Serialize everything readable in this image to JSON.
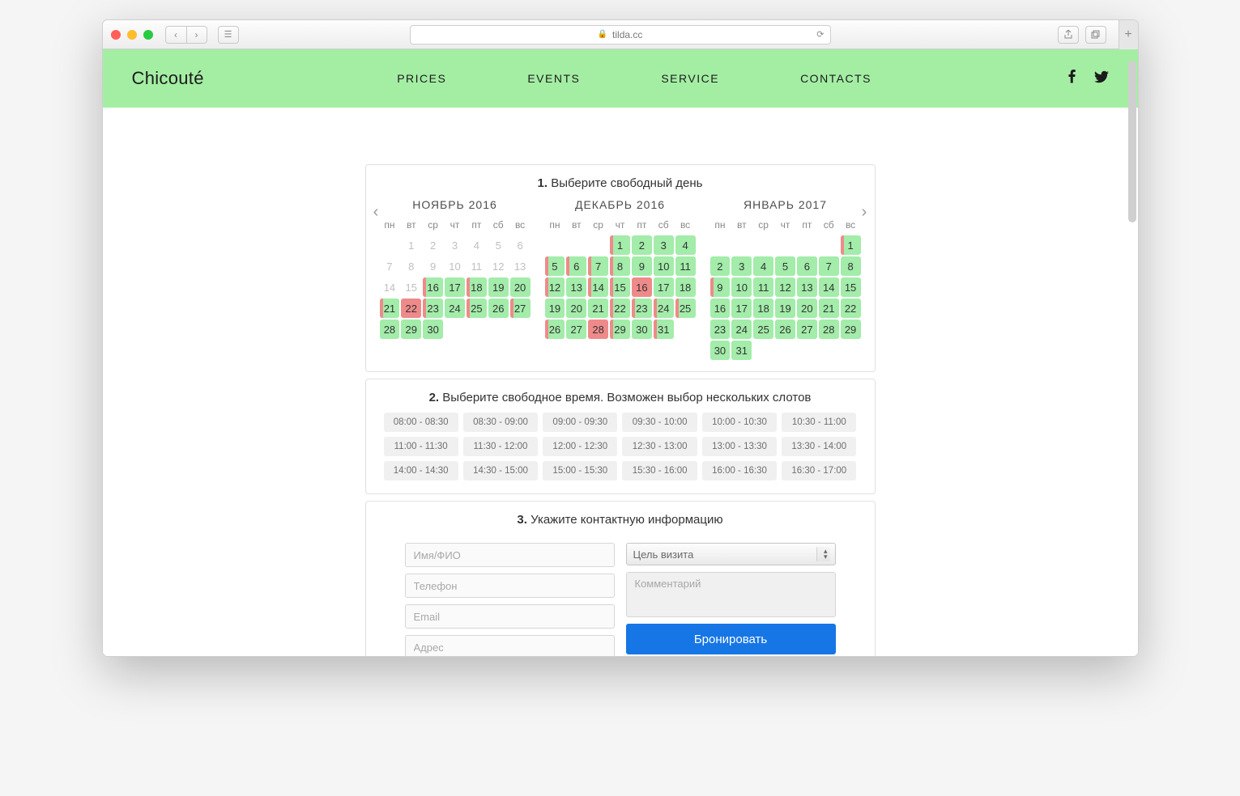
{
  "browser": {
    "url": "tilda.cc"
  },
  "brand": "Chicouté",
  "nav": [
    "PRICES",
    "EVENTS",
    "SERVICE",
    "CONTACTS"
  ],
  "step1": {
    "num": "1.",
    "title": "Выберите свободный день"
  },
  "step2": {
    "num": "2.",
    "title": "Выберите свободное время. Возможен выбор нескольких слотов"
  },
  "step3": {
    "num": "3.",
    "title": "Укажите контактную информацию"
  },
  "dow": [
    "пн",
    "вт",
    "ср",
    "чт",
    "пт",
    "сб",
    "вс"
  ],
  "months": [
    {
      "name": "НОЯБРЬ 2016",
      "offset": 1,
      "days": [
        {
          "n": 1,
          "s": "past"
        },
        {
          "n": 2,
          "s": "past"
        },
        {
          "n": 3,
          "s": "past"
        },
        {
          "n": 4,
          "s": "past"
        },
        {
          "n": 5,
          "s": "past"
        },
        {
          "n": 6,
          "s": "past"
        },
        {
          "n": 7,
          "s": "past"
        },
        {
          "n": 8,
          "s": "past"
        },
        {
          "n": 9,
          "s": "past"
        },
        {
          "n": 10,
          "s": "past"
        },
        {
          "n": 11,
          "s": "past"
        },
        {
          "n": 12,
          "s": "past"
        },
        {
          "n": 13,
          "s": "past"
        },
        {
          "n": 14,
          "s": "past"
        },
        {
          "n": 15,
          "s": "past"
        },
        {
          "n": 16,
          "s": "busy"
        },
        {
          "n": 17,
          "s": "avail"
        },
        {
          "n": 18,
          "s": "busy"
        },
        {
          "n": 19,
          "s": "avail"
        },
        {
          "n": 20,
          "s": "avail"
        },
        {
          "n": 21,
          "s": "busy"
        },
        {
          "n": 22,
          "s": "full"
        },
        {
          "n": 23,
          "s": "busy"
        },
        {
          "n": 24,
          "s": "avail"
        },
        {
          "n": 25,
          "s": "busy"
        },
        {
          "n": 26,
          "s": "avail"
        },
        {
          "n": 27,
          "s": "busy"
        },
        {
          "n": 28,
          "s": "avail"
        },
        {
          "n": 29,
          "s": "avail"
        },
        {
          "n": 30,
          "s": "avail"
        }
      ]
    },
    {
      "name": "ДЕКАБРЬ 2016",
      "offset": 3,
      "days": [
        {
          "n": 1,
          "s": "busy"
        },
        {
          "n": 2,
          "s": "avail"
        },
        {
          "n": 3,
          "s": "avail"
        },
        {
          "n": 4,
          "s": "avail"
        },
        {
          "n": 5,
          "s": "busy"
        },
        {
          "n": 6,
          "s": "busy"
        },
        {
          "n": 7,
          "s": "busy"
        },
        {
          "n": 8,
          "s": "busy"
        },
        {
          "n": 9,
          "s": "avail"
        },
        {
          "n": 10,
          "s": "avail"
        },
        {
          "n": 11,
          "s": "avail"
        },
        {
          "n": 12,
          "s": "busy"
        },
        {
          "n": 13,
          "s": "avail"
        },
        {
          "n": 14,
          "s": "busy"
        },
        {
          "n": 15,
          "s": "busy"
        },
        {
          "n": 16,
          "s": "full"
        },
        {
          "n": 17,
          "s": "avail"
        },
        {
          "n": 18,
          "s": "avail"
        },
        {
          "n": 19,
          "s": "avail"
        },
        {
          "n": 20,
          "s": "avail"
        },
        {
          "n": 21,
          "s": "avail"
        },
        {
          "n": 22,
          "s": "busy"
        },
        {
          "n": 23,
          "s": "busy"
        },
        {
          "n": 24,
          "s": "busy"
        },
        {
          "n": 25,
          "s": "busy"
        },
        {
          "n": 26,
          "s": "busy"
        },
        {
          "n": 27,
          "s": "avail"
        },
        {
          "n": 28,
          "s": "full"
        },
        {
          "n": 29,
          "s": "busy"
        },
        {
          "n": 30,
          "s": "avail"
        },
        {
          "n": 31,
          "s": "busy"
        }
      ]
    },
    {
      "name": "ЯНВАРЬ 2017",
      "offset": 6,
      "days": [
        {
          "n": 1,
          "s": "busy"
        },
        {
          "n": 2,
          "s": "avail"
        },
        {
          "n": 3,
          "s": "avail"
        },
        {
          "n": 4,
          "s": "avail"
        },
        {
          "n": 5,
          "s": "avail"
        },
        {
          "n": 6,
          "s": "avail"
        },
        {
          "n": 7,
          "s": "avail"
        },
        {
          "n": 8,
          "s": "avail"
        },
        {
          "n": 9,
          "s": "busy"
        },
        {
          "n": 10,
          "s": "avail"
        },
        {
          "n": 11,
          "s": "avail"
        },
        {
          "n": 12,
          "s": "avail"
        },
        {
          "n": 13,
          "s": "avail"
        },
        {
          "n": 14,
          "s": "avail"
        },
        {
          "n": 15,
          "s": "avail"
        },
        {
          "n": 16,
          "s": "avail"
        },
        {
          "n": 17,
          "s": "avail"
        },
        {
          "n": 18,
          "s": "avail"
        },
        {
          "n": 19,
          "s": "avail"
        },
        {
          "n": 20,
          "s": "avail"
        },
        {
          "n": 21,
          "s": "avail"
        },
        {
          "n": 22,
          "s": "avail"
        },
        {
          "n": 23,
          "s": "avail"
        },
        {
          "n": 24,
          "s": "avail"
        },
        {
          "n": 25,
          "s": "avail"
        },
        {
          "n": 26,
          "s": "avail"
        },
        {
          "n": 27,
          "s": "avail"
        },
        {
          "n": 28,
          "s": "avail"
        },
        {
          "n": 29,
          "s": "avail"
        },
        {
          "n": 30,
          "s": "avail"
        },
        {
          "n": 31,
          "s": "avail"
        }
      ]
    }
  ],
  "slots": [
    "08:00 - 08:30",
    "08:30 - 09:00",
    "09:00 - 09:30",
    "09:30 - 10:00",
    "10:00 - 10:30",
    "10:30 - 11:00",
    "11:00 - 11:30",
    "11:30 - 12:00",
    "12:00 - 12:30",
    "12:30 - 13:00",
    "13:00 - 13:30",
    "13:30 - 14:00",
    "14:00 - 14:30",
    "14:30 - 15:00",
    "15:00 - 15:30",
    "15:30 - 16:00",
    "16:00 - 16:30",
    "16:30 - 17:00"
  ],
  "form": {
    "name": "Имя/ФИО",
    "phone": "Телефон",
    "email": "Email",
    "address": "Адрес",
    "purpose": "Цель визита",
    "comment": "Комментарий",
    "submit": "Бронировать"
  }
}
